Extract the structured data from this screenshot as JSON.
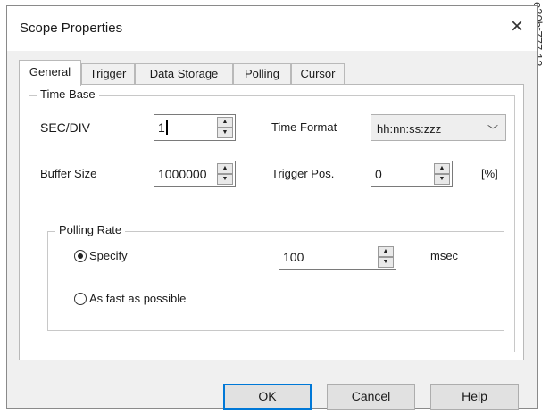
{
  "window": {
    "title": "Scope Properties",
    "close_label": "×"
  },
  "watermark": "e30bt777.12",
  "tabs": [
    {
      "label": "General",
      "active": true
    },
    {
      "label": "Trigger",
      "active": false
    },
    {
      "label": "Data Storage",
      "active": false
    },
    {
      "label": "Polling",
      "active": false
    },
    {
      "label": "Cursor",
      "active": false
    }
  ],
  "time_base": {
    "title": "Time Base",
    "sec_div_label": "SEC/DIV",
    "sec_div_value": "1",
    "time_format_label": "Time Format",
    "time_format_value": "hh:nn:ss:zzz",
    "buffer_size_label": "Buffer Size",
    "buffer_size_value": "1000000",
    "trigger_pos_label": "Trigger Pos.",
    "trigger_pos_value": "0",
    "trigger_pos_unit": "[%]"
  },
  "polling_rate": {
    "title": "Polling Rate",
    "specify_label": "Specify",
    "specify_selected": true,
    "rate_value": "100",
    "rate_unit": "msec",
    "fast_label": "As fast as possible",
    "fast_selected": false
  },
  "buttons": {
    "ok": "OK",
    "cancel": "Cancel",
    "help": "Help"
  },
  "icons": {
    "spin_up": "▲",
    "spin_down": "▼",
    "dropdown": "﹀"
  }
}
